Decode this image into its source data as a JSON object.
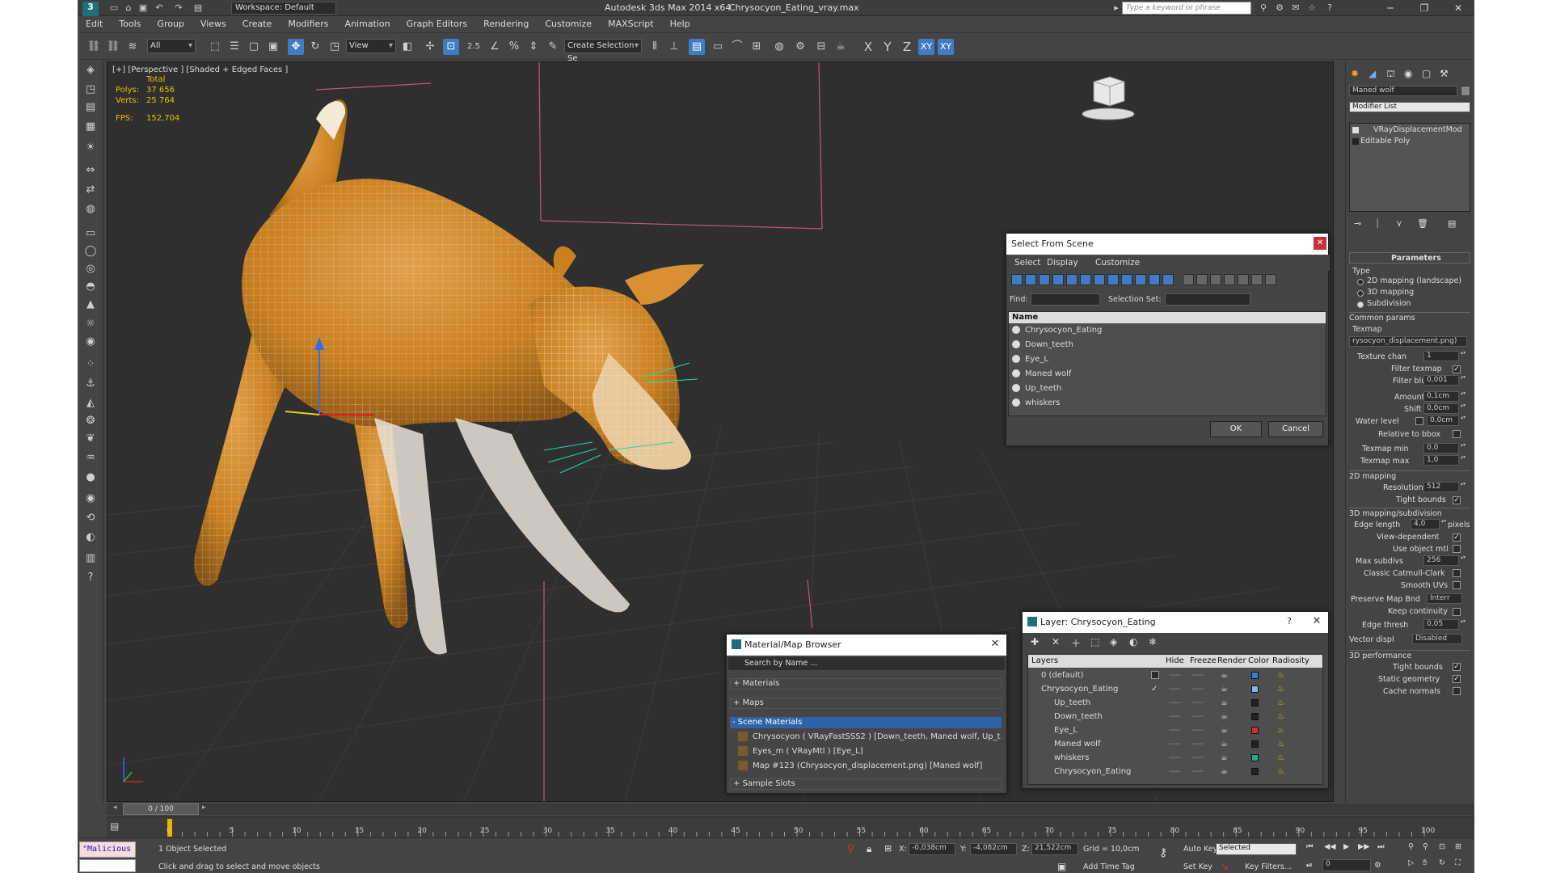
{
  "titlebar": {
    "app": "Autodesk 3ds Max  2014 x64",
    "file": "Chrysocyon_Eating_vray.max",
    "workspace": "Workspace: Default",
    "search_placeholder": "Type a keyword or phrase"
  },
  "menu": [
    "Edit",
    "Tools",
    "Group",
    "Views",
    "Create",
    "Modifiers",
    "Animation",
    "Graph Editors",
    "Rendering",
    "Customize",
    "MAXScript",
    "Help"
  ],
  "toolbar": {
    "filter": "All",
    "ref_coord": "View",
    "selection_set": "Create Selection Se",
    "snap": "2.5",
    "axis_x": "X",
    "axis_y": "Y",
    "axis_z": "Z",
    "axis_xy": "XY",
    "axis_xy2": "XY"
  },
  "viewport": {
    "label": "[+] [Perspective ] [Shaded + Edged Faces ]",
    "total_label": "Total",
    "polys_label": "Polys:",
    "polys": "37 656",
    "verts_label": "Verts:",
    "verts": "25 764",
    "fps_label": "FPS:",
    "fps": "152,704"
  },
  "command_panel": {
    "object_name": "Maned wolf",
    "modifier_list": "Modifier List",
    "stack": [
      "VRayDisplacementMod",
      "Editable Poly"
    ],
    "rollout": "Parameters",
    "type_label": "Type",
    "types": [
      "2D mapping (landscape)",
      "3D mapping",
      "Subdivision"
    ],
    "common_params": "Common params",
    "texmap_label": "Texmap",
    "texmap": "rysocyon_displacement.png)",
    "texture_chan_label": "Texture chan",
    "texture_chan": "1",
    "filter_texmap": "Filter texmap",
    "filter_blur_label": "Filter blur",
    "filter_blur": "0,001",
    "amount_label": "Amount",
    "amount": "0,1cm",
    "shift_label": "Shift",
    "shift": "0,0cm",
    "water_level_label": "Water level",
    "water_level": "0,0cm",
    "relative_bbox": "Relative to bbox",
    "texmap_min_label": "Texmap min",
    "texmap_min": "0,0",
    "texmap_max_label": "Texmap max",
    "texmap_max": "1,0",
    "mapping2d": "2D mapping",
    "resolution_label": "Resolution",
    "resolution": "512",
    "tight_bounds": "Tight bounds",
    "mapping3d": "3D mapping/subdivision",
    "edge_length_label": "Edge length",
    "edge_length": "4,0",
    "pixels": "pixels",
    "view_dependent": "View-dependent",
    "use_object_mtl": "Use object mtl",
    "max_subdivs_label": "Max subdivs",
    "max_subdivs": "256",
    "catmull": "Classic Catmull-Clark",
    "smooth_uvs": "Smooth UVs",
    "preserve_label": "Preserve Map Bnd",
    "preserve": "Interr",
    "keep_continuity": "Keep continuity",
    "edge_thresh_label": "Edge thresh",
    "edge_thresh": "0,05",
    "vector_displ_label": "Vector displ",
    "vector_displ": "Disabled",
    "perf": "3D performance",
    "tight_bounds2": "Tight bounds",
    "static_geometry": "Static geometry",
    "cache_normals": "Cache normals"
  },
  "select_dialog": {
    "title": "Select From Scene",
    "menu": [
      "Select",
      "Display",
      "Customize"
    ],
    "find_label": "Find:",
    "selset_label": "Selection Set:",
    "col_name": "Name",
    "items": [
      "Chrysocyon_Eating",
      "Down_teeth",
      "Eye_L",
      "Maned wolf",
      "Up_teeth",
      "whiskers"
    ],
    "ok": "OK",
    "cancel": "Cancel"
  },
  "material_browser": {
    "title": "Material/Map Browser",
    "search": "Search by Name ...",
    "materials": "+ Materials",
    "maps": "+ Maps",
    "scene": "- Scene Materials",
    "entries": [
      "Chrysocyon  ( VRayFastSSS2 )  [Down_teeth, Maned wolf, Up_t...",
      "Eyes_m  ( VRayMtl )  [Eye_L]",
      "Map #123 (Chrysocyon_displacement.png) [Maned wolf]"
    ],
    "samples": "+ Sample Slots"
  },
  "layer_dialog": {
    "title": "Layer: Chrysocyon_Eating",
    "help": "?",
    "cols": [
      "Layers",
      "Hide",
      "Freeze",
      "Render",
      "Color",
      "Radiosity"
    ],
    "rows": [
      {
        "name": "0 (default)",
        "color": "#3d7fd6"
      },
      {
        "name": "Chrysocyon_Eating",
        "color": "#8ab4e6"
      },
      {
        "name": "Up_teeth",
        "color": "#222222"
      },
      {
        "name": "Down_teeth",
        "color": "#222222"
      },
      {
        "name": "Eye_L",
        "color": "#d03030"
      },
      {
        "name": "Maned wolf",
        "color": "#222222"
      },
      {
        "name": "whiskers",
        "color": "#1fae88"
      },
      {
        "name": "Chrysocyon_Eating",
        "color": "#222222"
      }
    ],
    "dashes": "----"
  },
  "timeline": {
    "frame": "0 / 100",
    "ticks": [
      "0",
      "5",
      "10",
      "15",
      "20",
      "25",
      "30",
      "35",
      "40",
      "45",
      "50",
      "55",
      "60",
      "65",
      "70",
      "75",
      "80",
      "85",
      "90",
      "95",
      "100"
    ]
  },
  "status": {
    "script": "\"Malicious s",
    "selected": "1 Object Selected",
    "prompt": "Click and drag to select and move objects",
    "x_label": "X:",
    "x": "-0,038cm",
    "y_label": "Y:",
    "y": "-4,082cm",
    "z_label": "Z:",
    "z": "21,522cm",
    "grid": "Grid = 10,0cm",
    "auto_key": "Auto Key",
    "key_mode": "Selected",
    "set_key": "Set Key",
    "key_filters": "Key Filters...",
    "add_time_tag": "Add Time Tag",
    "frame_field": "0"
  }
}
